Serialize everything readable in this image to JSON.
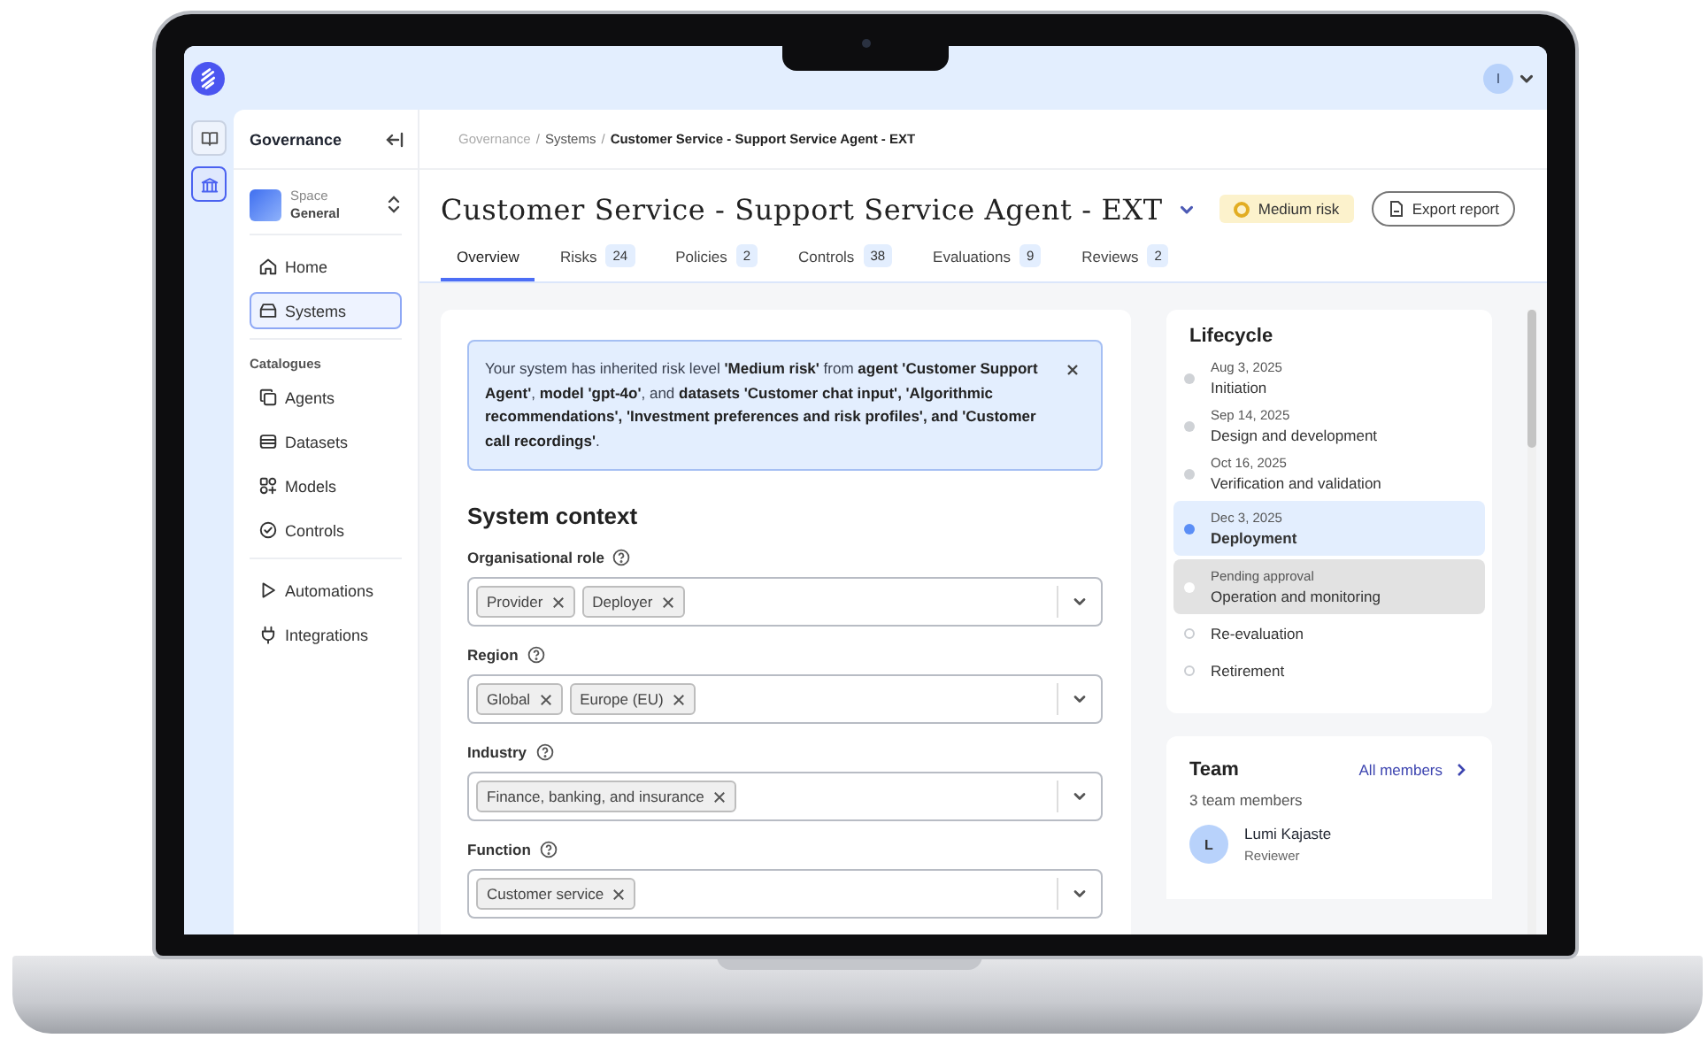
{
  "top_bar": {
    "avatar_initial": "I"
  },
  "rail": [
    {
      "kind": "book",
      "selected": false
    },
    {
      "kind": "bank",
      "selected": true
    }
  ],
  "sidebar": {
    "title": "Governance",
    "space": {
      "label": "Space",
      "name": "General"
    },
    "nav_groups": [
      {
        "items": [
          {
            "label": "Home",
            "kind": "home",
            "selected": false
          },
          {
            "label": "Systems",
            "kind": "systems",
            "selected": true
          }
        ]
      },
      {
        "heading": "Catalogues",
        "items": [
          {
            "label": "Agents",
            "kind": "agents",
            "selected": false
          },
          {
            "label": "Datasets",
            "kind": "datasets",
            "selected": false
          },
          {
            "label": "Models",
            "kind": "models",
            "selected": false
          },
          {
            "label": "Controls",
            "kind": "controls",
            "selected": false
          }
        ]
      },
      {
        "items": [
          {
            "label": "Automations",
            "kind": "automations",
            "selected": false
          },
          {
            "label": "Integrations",
            "kind": "integrations",
            "selected": false
          }
        ]
      }
    ]
  },
  "breadcrumb": {
    "separator": "/",
    "items": [
      "Governance",
      "Systems",
      "Customer Service - Support Service Agent - EXT"
    ]
  },
  "title": "Customer Service - Support Service Agent - EXT",
  "risk_badge": "Medium risk",
  "export_button": "Export report",
  "tabs": [
    {
      "label": "Overview",
      "selected": true
    },
    {
      "label": "Risks",
      "count": "24",
      "selected": false
    },
    {
      "label": "Policies",
      "count": "2",
      "selected": false
    },
    {
      "label": "Controls",
      "count": "38",
      "selected": false
    },
    {
      "label": "Evaluations",
      "count": "9",
      "selected": false
    },
    {
      "label": "Reviews",
      "count": "2",
      "selected": false
    }
  ],
  "alert": "Your system has inherited risk level **'Medium risk'** from **agent 'Customer Support Agent'**, **model 'gpt-4o'**, and **datasets 'Customer chat input', 'Algorithmic recommendations', 'Investment preferences and risk profiles', and 'Customer call recordings'**.",
  "system_context": {
    "title": "System context",
    "fields": [
      {
        "label": "Organisational role",
        "tags": [
          "Provider",
          "Deployer"
        ]
      },
      {
        "label": "Region",
        "tags": [
          "Global",
          "Europe (EU)"
        ]
      },
      {
        "label": "Industry",
        "tags": [
          "Finance, banking, and insurance"
        ]
      },
      {
        "label": "Function",
        "tags": [
          "Customer service"
        ]
      }
    ]
  },
  "lifecycle": {
    "title": "Lifecycle",
    "stages": [
      {
        "date": "Aug 3, 2025",
        "name": "Initiation",
        "kind": "done"
      },
      {
        "date": "Sep 14, 2025",
        "name": "Design and development",
        "kind": "done"
      },
      {
        "date": "Oct 16, 2025",
        "name": "Verification and validation",
        "kind": "done"
      },
      {
        "date": "Dec 3, 2025",
        "name": "Deployment",
        "kind": "current"
      },
      {
        "date": "Pending approval",
        "name": "Operation and monitoring",
        "kind": "pending"
      },
      {
        "name": "Re-evaluation",
        "kind": "future"
      },
      {
        "name": "Retirement",
        "kind": "future"
      }
    ]
  },
  "team": {
    "title": "Team",
    "link": "All members",
    "count": "3 team members",
    "members": [
      {
        "initial": "L",
        "name": "Lumi Kajaste",
        "role": "Reviewer"
      }
    ]
  }
}
